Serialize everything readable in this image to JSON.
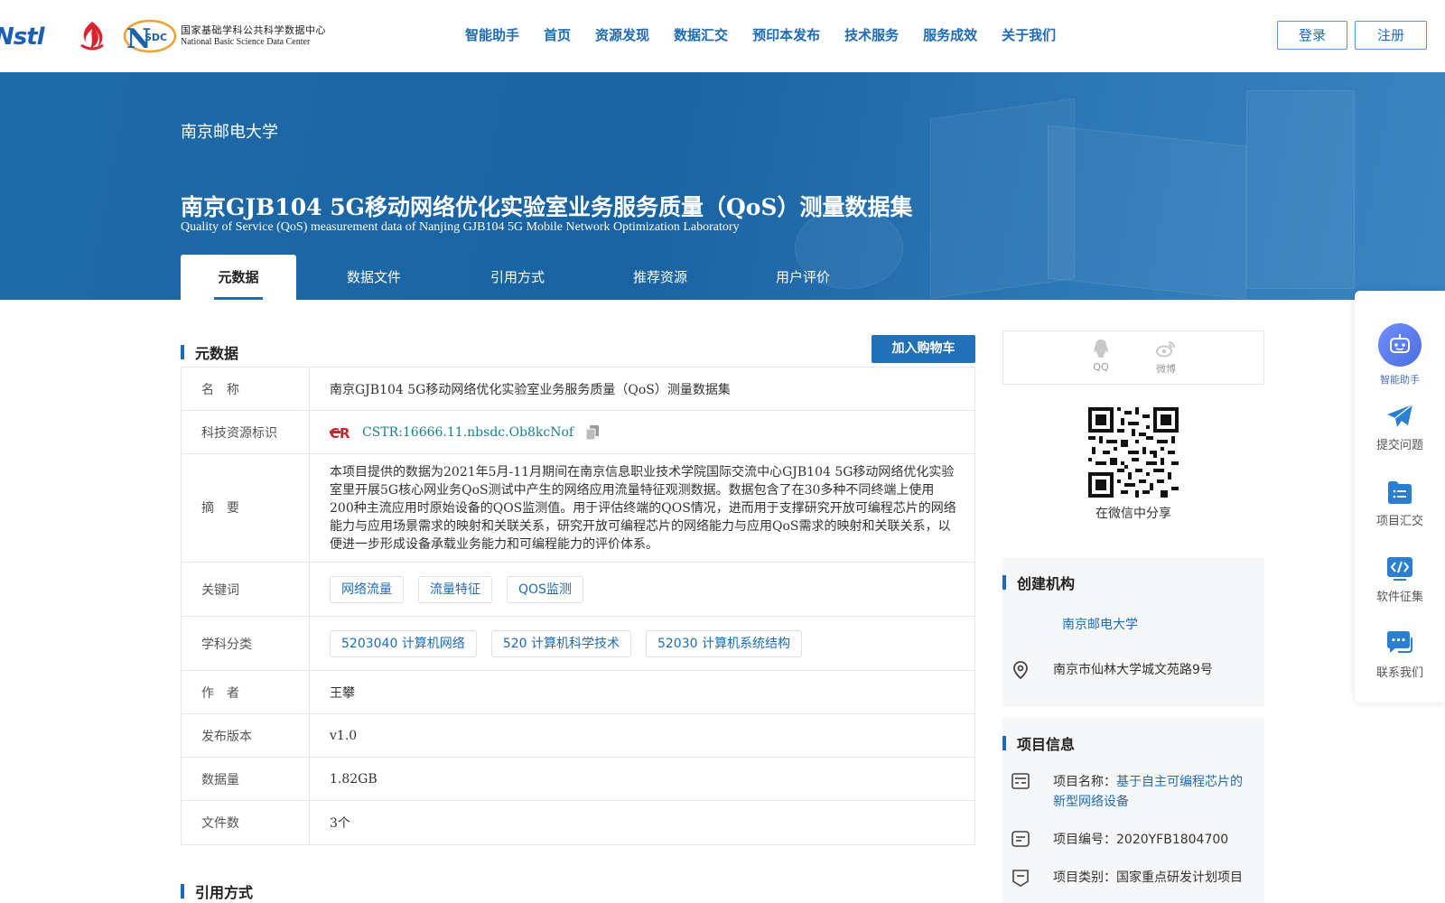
{
  "header": {
    "logo_nstl": "Nstl",
    "logo_nsdc_badge": "SDC",
    "logo_nsdc_cn": "国家基础学科公共科学数据中心",
    "logo_nsdc_en": "National Basic Science Data Center",
    "nav": [
      "智能助手",
      "首页",
      "资源发现",
      "数据汇交",
      "预印本发布",
      "技术服务",
      "服务成效",
      "关于我们"
    ],
    "login": "登录",
    "register": "注册"
  },
  "banner": {
    "org": "南京邮电大学",
    "title": "南京GJB104 5G移动网络优化实验室业务服务质量（QoS）测量数据集",
    "subtitle": "Quality of Service (QoS) measurement data of Nanjing GJB104 5G Mobile Network Optimization Laboratory",
    "tabs": [
      "元数据",
      "数据文件",
      "引用方式",
      "推荐资源",
      "用户评价"
    ]
  },
  "metadata": {
    "section_title": "元数据",
    "cart_button": "加入购物车",
    "rows": {
      "name_label": "名　称",
      "name_value": "南京GJB104 5G移动网络优化实验室业务服务质量（QoS）测量数据集",
      "cstr_label": "科技资源标识",
      "cstr_value": "CSTR:16666.11.nbsdc.Ob8kcNof",
      "abstract_label": "摘　要",
      "abstract_value": "本项目提供的数据为2021年5月-11月期间在南京信息职业技术学院国际交流中心GJB104 5G移动网络优化实验室里开展5G核心网业务QoS测试中产生的网络应用流量特征观测数据。数据包含了在30多种不同终端上使用200种主流应用时原始设备的QOS监测值。用于评估终端的QOS情况，进而用于支撑研究开放可编程芯片的网络能力与应用场景需求的映射和关联关系，研究开放可编程芯片的网络能力与应用QoS需求的映射和关联关系，以便进一步形成设备承载业务能力和可编程能力的评价体系。",
      "keywords_label": "关键词",
      "keywords": [
        "网络流量",
        "流量特征",
        "QOS监测"
      ],
      "subject_label": "学科分类",
      "subjects": [
        "5203040 计算机网络",
        "520 计算机科学技术",
        "52030 计算机系统结构"
      ],
      "author_label": "作　者",
      "author_value": "王攀",
      "version_label": "发布版本",
      "version_value": "v1.0",
      "size_label": "数据量",
      "size_value": "1.82GB",
      "files_label": "文件数",
      "files_value": "3个"
    }
  },
  "citation": {
    "section_title": "引用方式"
  },
  "share": {
    "qq": "QQ",
    "weibo": "微博",
    "wechat_caption": "在微信中分享"
  },
  "org_card": {
    "title": "创建机构",
    "org_link": "南京邮电大学",
    "address": "南京市仙林大学城文苑路9号"
  },
  "project_card": {
    "title": "项目信息",
    "name_label": "项目名称：",
    "name_value": "基于自主可编程芯片的新型网络设备",
    "code_label": "项目编号：",
    "code_value": "2020YFB1804700",
    "type_label": "项目类别：",
    "type_value": "国家重点研发计划项目"
  },
  "side_panel": {
    "assistant": "智能助手",
    "submit": "提交问题",
    "project": "项目汇交",
    "software": "软件征集",
    "contact": "联系我们"
  },
  "colors": {
    "primary": "#1d6bb8",
    "banner": "#1f6aa8",
    "cstr": "#17808a"
  }
}
